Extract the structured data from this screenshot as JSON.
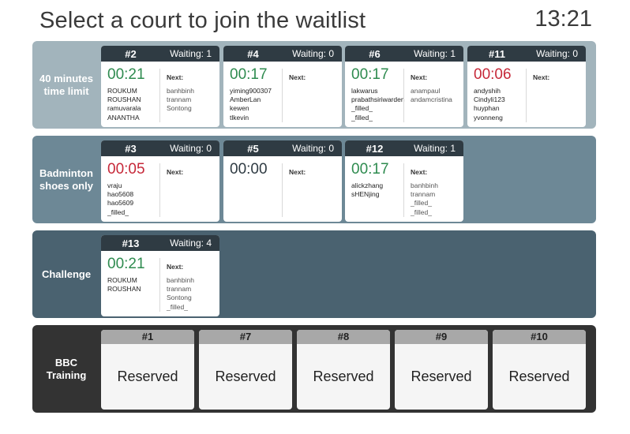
{
  "header": {
    "title": "Select a court to join the waitlist",
    "clock": "13:21"
  },
  "sections": [
    {
      "label": "40 minutes time limit",
      "courts": [
        {
          "number": "#2",
          "waiting": "Waiting:  1",
          "timer": "00:21",
          "timer_color": "green",
          "players": [
            "ROUKUM",
            "ROUSHAN",
            "ramuvarala",
            "ANANTHA"
          ],
          "next_label": "Next:",
          "next": [
            "banhbinh",
            "trannam",
            "Sontong"
          ]
        },
        {
          "number": "#4",
          "waiting": "Waiting:  0",
          "timer": "00:17",
          "timer_color": "green",
          "players": [
            "yiming900307",
            "AmberLan",
            "kewen",
            "tlkevin"
          ],
          "next_label": "Next:",
          "next": []
        },
        {
          "number": "#6",
          "waiting": "Waiting:  1",
          "timer": "00:17",
          "timer_color": "green",
          "players": [
            "lakwarus",
            "prabathsiriwarden",
            "_filled_",
            "_filled_"
          ],
          "next_label": "Next:",
          "next": [
            "anampaul",
            "andamcristina"
          ]
        },
        {
          "number": "#11",
          "waiting": "Waiting:  0",
          "timer": "00:06",
          "timer_color": "red",
          "players": [
            "andyshih",
            "Cindyli123",
            "huyphan",
            "yvonneng"
          ],
          "next_label": "Next:",
          "next": []
        }
      ]
    },
    {
      "label": "Badminton shoes only",
      "courts": [
        {
          "number": "#3",
          "waiting": "Waiting:  0",
          "timer": "00:05",
          "timer_color": "red",
          "players": [
            "vraju",
            "hao5608",
            "hao5609",
            "_filled_"
          ],
          "next_label": "Next:",
          "next": []
        },
        {
          "number": "#5",
          "waiting": "Waiting:  0",
          "timer": "00:00",
          "timer_color": "dark",
          "players": [],
          "next_label": "Next:",
          "next": []
        },
        {
          "number": "#12",
          "waiting": "Waiting:  1",
          "timer": "00:17",
          "timer_color": "green",
          "players": [
            "alickzhang",
            "sHENjing"
          ],
          "next_label": "Next:",
          "next": [
            "banhbinh",
            "trannam",
            "_filled_",
            "_filled_"
          ]
        }
      ]
    },
    {
      "label": "Challenge",
      "courts": [
        {
          "number": "#13",
          "waiting": "Waiting:  4",
          "timer": "00:21",
          "timer_color": "green",
          "players": [
            "ROUKUM",
            "ROUSHAN"
          ],
          "next_label": "Next:",
          "next": [
            "banhbinh",
            "trannam",
            "Sontong",
            "_filled_"
          ]
        }
      ]
    },
    {
      "label": "BBC Training",
      "reserved": [
        {
          "number": "#1",
          "status": "Reserved"
        },
        {
          "number": "#7",
          "status": "Reserved"
        },
        {
          "number": "#8",
          "status": "Reserved"
        },
        {
          "number": "#9",
          "status": "Reserved"
        },
        {
          "number": "#10",
          "status": "Reserved"
        }
      ]
    }
  ],
  "colors": {
    "section_1": "#a2b4bc",
    "section_2": "#6d8896",
    "section_3": "#4a6270",
    "section_4": "#333333",
    "card_header": "#2f3b43",
    "timer_green": "#2e8b4f",
    "timer_red": "#c62839"
  }
}
